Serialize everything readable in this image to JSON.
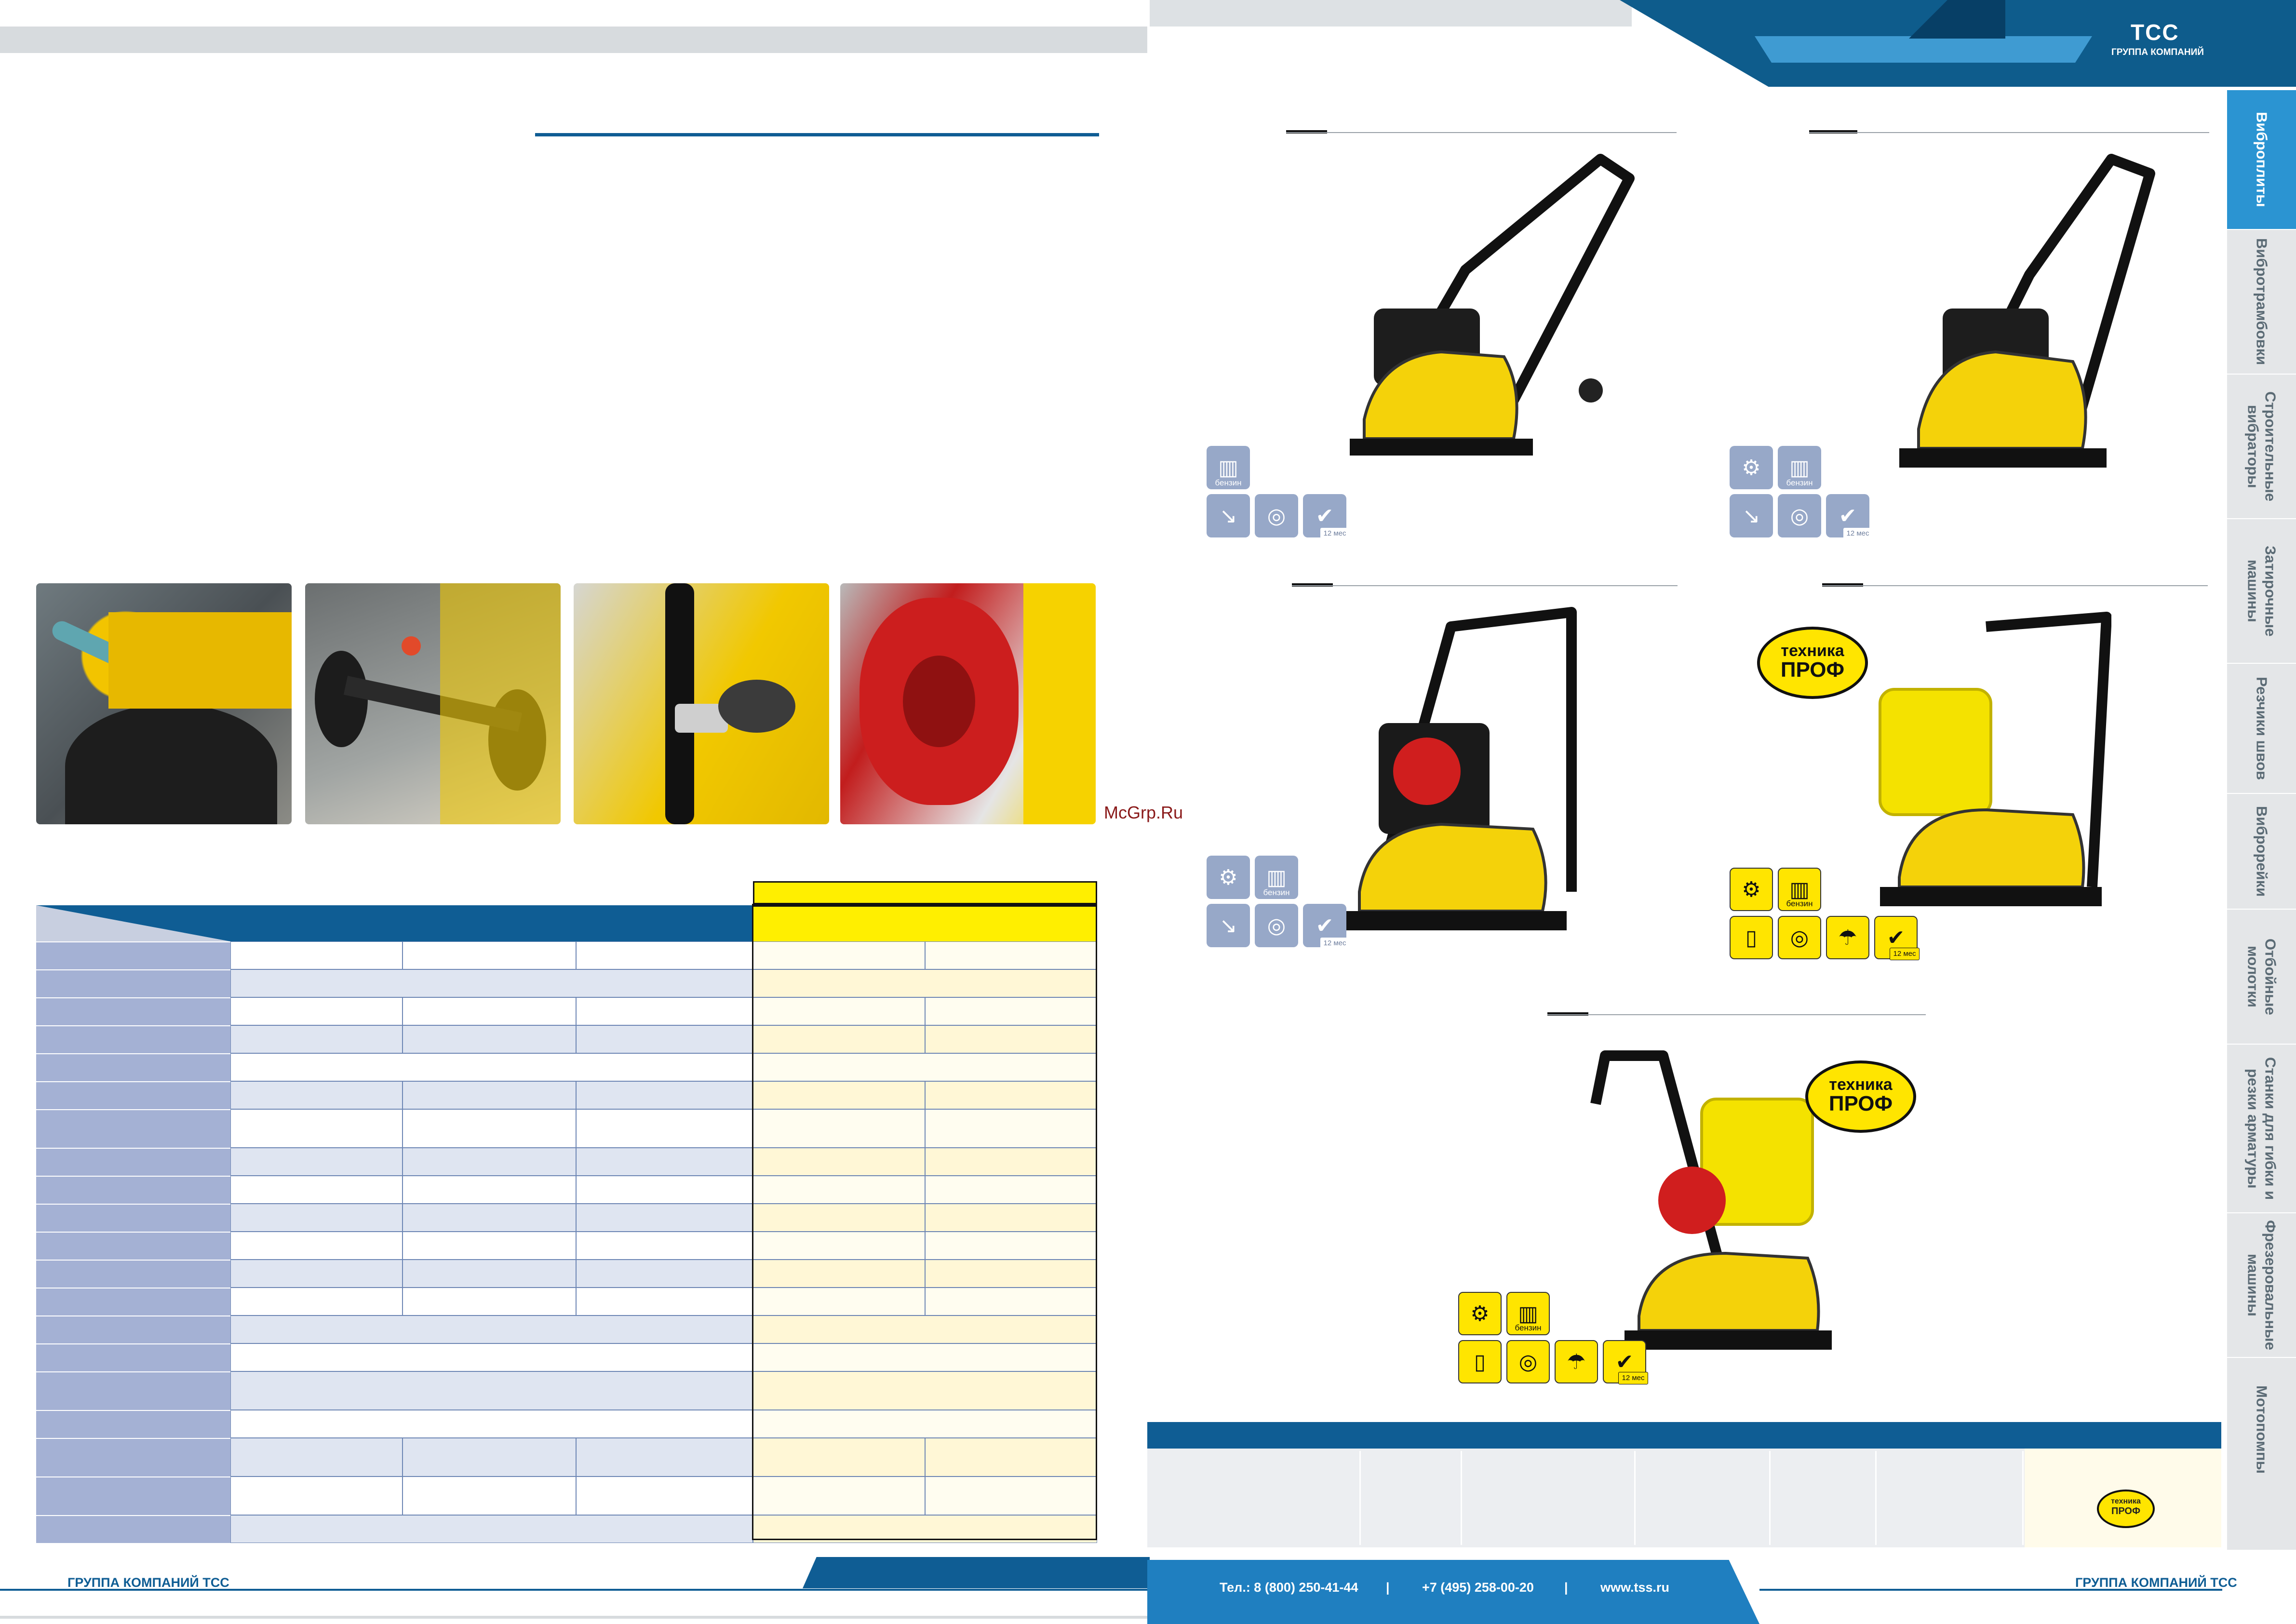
{
  "brand": {
    "logo_text": "TCC",
    "logo_sub": "ГРУППА КОМПАНИЙ"
  },
  "watermark": "McGrp.Ru",
  "icons": {
    "engine": "engine-icon",
    "fuel": "fuel-can-icon",
    "fuel_label": "бензин",
    "compaction": "compaction-icon",
    "tank": "water-tank-icon",
    "sprinkler": "sprinkler-icon",
    "wheel": "wheel-icon",
    "warranty": "warranty-check-icon",
    "warranty_label": "12 мес"
  },
  "badge": {
    "line1": "техника",
    "line2": "ПРОФ"
  },
  "sidebar": {
    "items": [
      {
        "label": "Виброплиты",
        "active": true
      },
      {
        "label": "Вибротрамбовки",
        "active": false
      },
      {
        "label": "Строительные\nвибраторы",
        "active": false
      },
      {
        "label": "Затирочные\nмашины",
        "active": false
      },
      {
        "label": "Резчики швов",
        "active": false
      },
      {
        "label": "Виброрейки",
        "active": false
      },
      {
        "label": "Отбойные\nмолотки",
        "active": false
      },
      {
        "label": "Станки для гибки и\nрезки арматуры",
        "active": false
      },
      {
        "label": "Фрезеровальные\nмашины",
        "active": false
      },
      {
        "label": "Мотопомпы",
        "active": false
      }
    ]
  },
  "footer": {
    "left_company": "ГРУППА КОМПАНИЙ ТСС",
    "right_company": "ГРУППА КОМПАНИЙ ТСС",
    "phone1": "Тел.: 8 (800) 250-41-44",
    "sep": "|",
    "phone2": "+7 (495) 258-00-20",
    "site": "www.tss.ru"
  },
  "colors": {
    "brand_blue": "#0f5d94",
    "accent_blue": "#2b94d2",
    "accent_yellow": "#ffe500",
    "icon_grey": "#97a8c8"
  }
}
